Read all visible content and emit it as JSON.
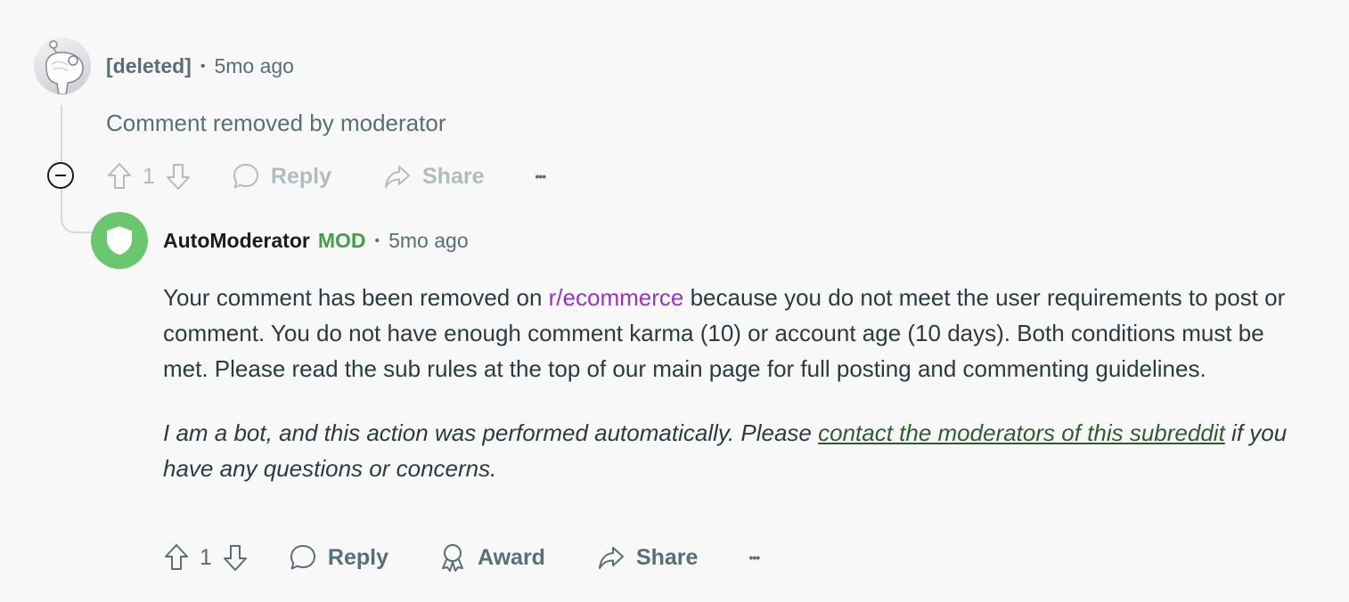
{
  "parent_comment": {
    "author": "[deleted]",
    "separator": "•",
    "time": "5mo ago",
    "body": "Comment removed by moderator",
    "vote_count": "1",
    "reply_label": "Reply",
    "share_label": "Share",
    "more_label": "•••"
  },
  "reply_comment": {
    "author": "AutoModerator",
    "mod_badge": "MOD",
    "separator": "•",
    "time": "5mo ago",
    "body_before_link": "Your comment has been removed on ",
    "subreddit_link": "r/ecommerce",
    "body_after_link": " because you do not meet the user requirements to post or comment. You do not have enough comment karma (10) or account age (10 days). Both conditions must be met. Please read the sub rules at the top of our main page for full posting and commenting guidelines.",
    "bot_before_link": "I am a bot, and this action was performed automatically. Please ",
    "contact_link": "contact the moderators of this subreddit",
    "bot_after_link": " if you have any questions or concerns.",
    "vote_count": "1",
    "reply_label": "Reply",
    "award_label": "Award",
    "share_label": "Share",
    "more_label": "•••"
  },
  "icons": {
    "upvote": "upvote-icon",
    "downvote": "downvote-icon",
    "reply": "speech-bubble-icon",
    "award": "award-icon",
    "share": "share-arrow-icon",
    "collapse": "minus-circle-icon",
    "mod_avatar": "shield-icon"
  },
  "colors": {
    "background": "#f8f8f9",
    "mod_green": "#46a049",
    "subreddit_link": "#9a34c8",
    "contact_link": "#2f5d2f",
    "muted": "#576f76"
  }
}
